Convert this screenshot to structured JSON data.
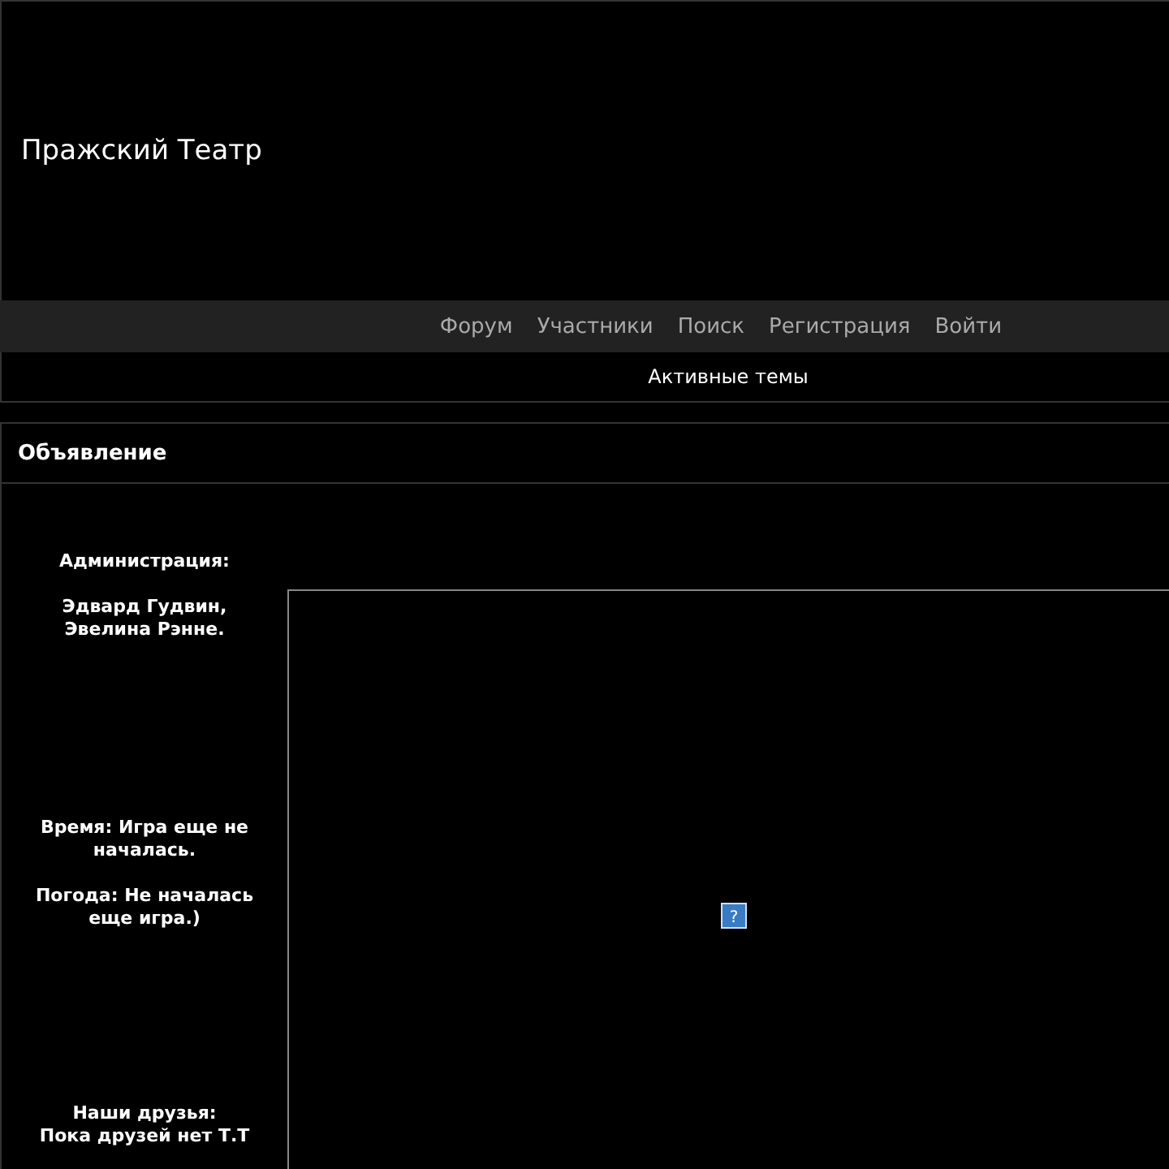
{
  "site": {
    "title": "Пражский Театр"
  },
  "nav": [
    {
      "label": "Форум"
    },
    {
      "label": "Участники"
    },
    {
      "label": "Поиск"
    },
    {
      "label": "Регистрация"
    },
    {
      "label": "Войти"
    }
  ],
  "subnav": [
    {
      "label": "Активные темы"
    }
  ],
  "announcement": {
    "title": "Объявление",
    "frame_icon": "?",
    "sidebar": [
      {
        "kind": "admin",
        "lines": [
          "Администрация:",
          "Эдвард Гудвин,\nЭвелина Рэнне."
        ]
      },
      {
        "kind": "status",
        "lines": [
          "Время: Игра еще не началась.",
          "Погода: Не началась еще игра.)"
        ]
      },
      {
        "kind": "friends",
        "lines": [
          "Наши друзья:\nПока друзей нет Т.Т"
        ]
      }
    ]
  }
}
